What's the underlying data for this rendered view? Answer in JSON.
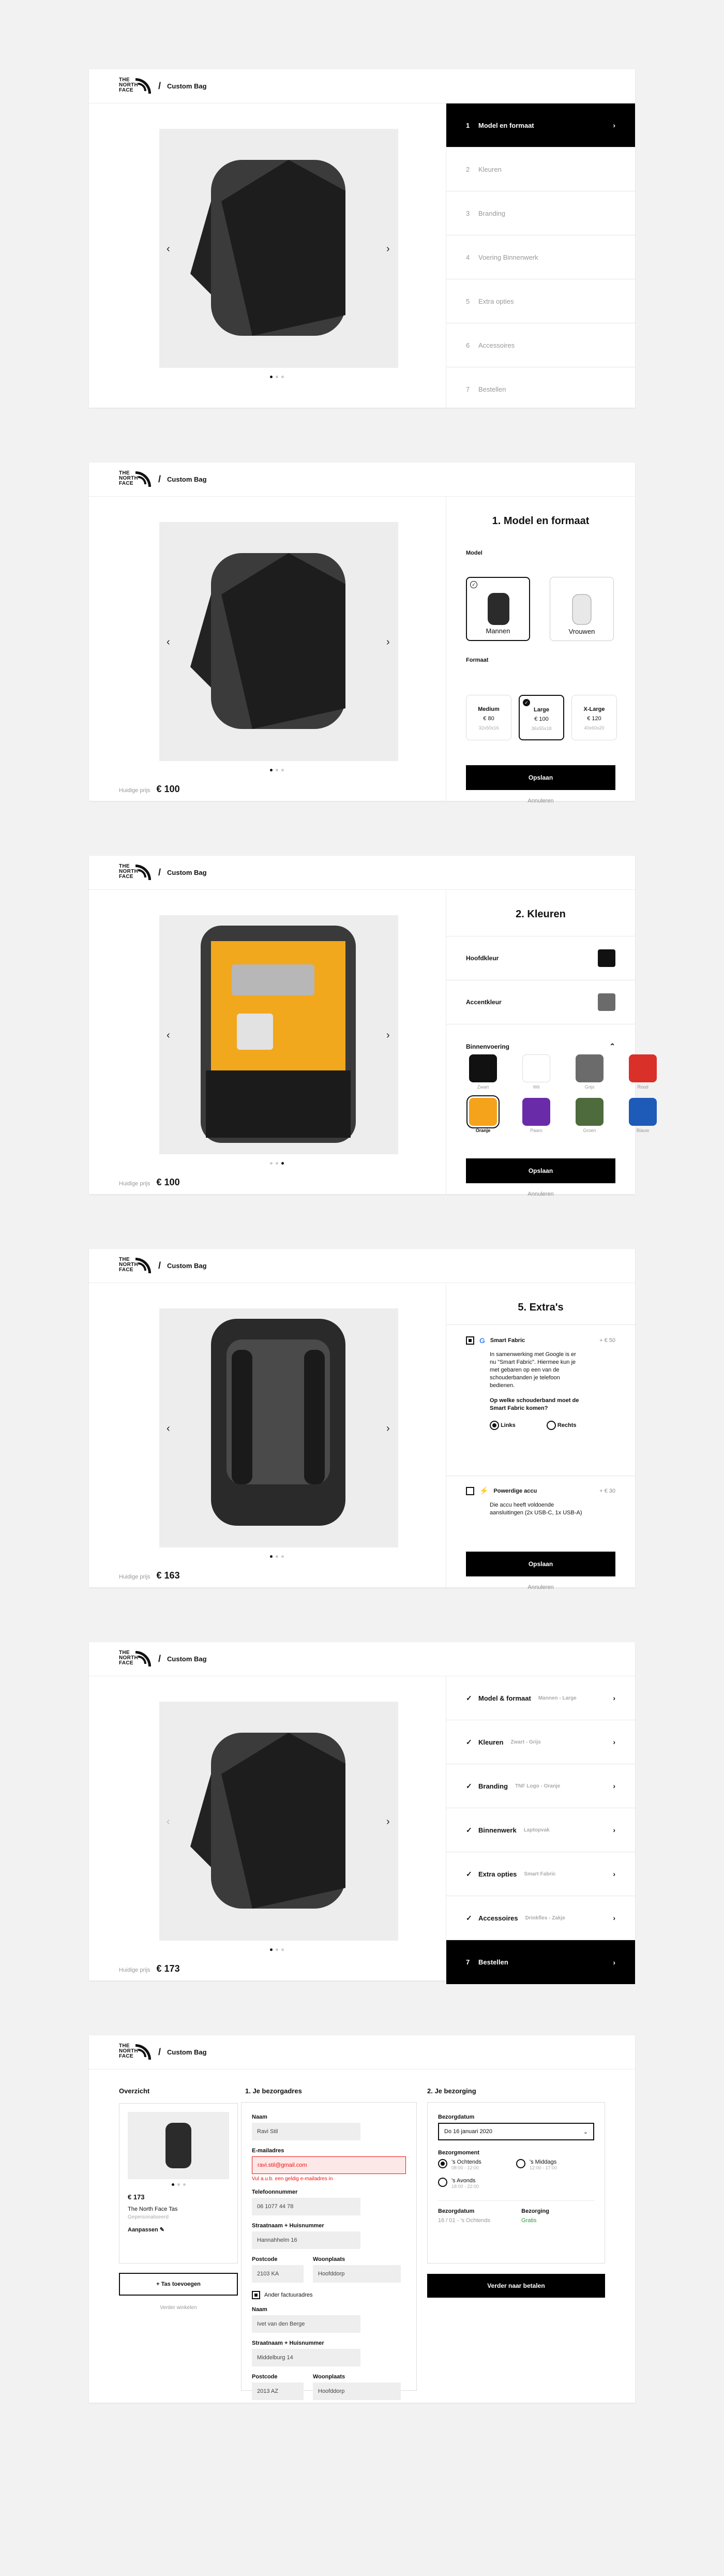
{
  "brand": {
    "logo_text": "THE NORTH FACE",
    "crumb": "Custom Bag"
  },
  "carousel": {
    "prev": "‹",
    "next": "›"
  },
  "common": {
    "price_label": "Huidige prijs",
    "save": "Opslaan",
    "cancel": "Annuleren"
  },
  "s1": {
    "steps": [
      {
        "n": "1",
        "label": "Model en formaat"
      },
      {
        "n": "2",
        "label": "Kleuren"
      },
      {
        "n": "3",
        "label": "Branding"
      },
      {
        "n": "4",
        "label": "Voering Binnenwerk"
      },
      {
        "n": "5",
        "label": "Extra opties"
      },
      {
        "n": "6",
        "label": "Accessoires"
      },
      {
        "n": "7",
        "label": "Bestellen"
      }
    ]
  },
  "s2": {
    "title": "1.   Model en formaat",
    "price": "€ 100",
    "model_label": "Model",
    "men": "Mannen",
    "women": "Vrouwen",
    "size_label": "Formaat",
    "sizes": [
      {
        "name": "Medium",
        "price": "€ 80",
        "dim": "32x50x16"
      },
      {
        "name": "Large",
        "price": "€ 100",
        "dim": "36x55x18"
      },
      {
        "name": "X-Large",
        "price": "€ 120",
        "dim": "40x60x20"
      }
    ]
  },
  "s3": {
    "title": "2.   Kleuren",
    "price": "€ 100",
    "main": "Hoofdkleur",
    "accent": "Accentkleur",
    "inner": "Binnenvoering",
    "swatches": [
      {
        "name": "Zwart",
        "color": "#111111"
      },
      {
        "name": "Wit",
        "color": "#ffffff"
      },
      {
        "name": "Grijs",
        "color": "#6b6b6b"
      },
      {
        "name": "Rood",
        "color": "#d9302a"
      },
      {
        "name": "Oranje",
        "color": "#f5a31a"
      },
      {
        "name": "Paars",
        "color": "#6a2ba8"
      },
      {
        "name": "Groen",
        "color": "#4d6b3d"
      },
      {
        "name": "Blauw",
        "color": "#1e5bb8"
      }
    ]
  },
  "s4": {
    "title": "5.   Extra's",
    "price": "€ 163",
    "o1": {
      "name": "Smart Fabric",
      "price": "+ € 50",
      "desc": "In samenwerking met Google is er nu \"Smart Fabric\". Hiermee kun je met gebaren op een van de schouderbanden je telefoon bedienen.",
      "q": "Op welke schouderband moet de Smart Fabric komen?",
      "left": "Links",
      "right": "Rechts"
    },
    "o2": {
      "name": "Powerdige accu",
      "price": "+ € 30",
      "desc": "Die accu heeft voldoende aansluitingen (2x USB-C, 1x USB-A)"
    }
  },
  "s5": {
    "price": "€ 173",
    "steps": [
      {
        "label": "Model & formaat",
        "sub": "Mannen - Large"
      },
      {
        "label": "Kleuren",
        "sub": "Zwart - Grijs"
      },
      {
        "label": "Branding",
        "sub": "TNF Logo - Oranje"
      },
      {
        "label": "Binnenwerk",
        "sub": "Laptopvak"
      },
      {
        "label": "Extra opties",
        "sub": "Smart Fabric"
      },
      {
        "label": "Accessoires",
        "sub": "Drinkfles - Zakje"
      },
      {
        "label": "Bestellen",
        "n": "7"
      }
    ]
  },
  "s6": {
    "overview": "Overzicht",
    "h1": "1. Je bezorgadres",
    "h2": "2. Je bezorging",
    "sum_price": "€ 173",
    "sum_name": "The North Face Tas",
    "sum_sub": "Gepersonaliseerd",
    "edit": "Aanpassen",
    "add": "Tas toevoegen",
    "continue": "Verder winkelen",
    "f": {
      "naam_l": "Naam",
      "naam": "Ravi Stil",
      "mail_l": "E-mailadres",
      "mail": "ravi.stil@gmail.com",
      "mail_err": "Vul a.u.b. een geldig e-mailadres in",
      "tel_l": "Telefoonnummer",
      "tel": "06 1077 44 78",
      "str_l": "Straatnaam + Huisnummer",
      "str": "Hannahhelm 16",
      "pc_l": "Postcode",
      "pc": "2103 KA",
      "wp_l": "Woonplaats",
      "wp": "Hoofddorp",
      "alt": "Ander factuuradres",
      "naam2": "Ivet van den Berge",
      "str2": "Middelburg 14",
      "pc2": "2013 AZ",
      "wp2": "Hoofddorp"
    },
    "d": {
      "date_l": "Bezorgdatum",
      "date": "Do 16 januari 2020",
      "slot_l": "Bezorgmoment",
      "slots": [
        {
          "t": "'s Ochtends",
          "h": "08:00 - 12:00"
        },
        {
          "t": "'s Middags",
          "h": "12:00 - 17:00"
        },
        {
          "t": "'s Avonds",
          "h": "18:00 - 22:00"
        }
      ],
      "sum_date_l": "Bezorgdatum",
      "sum_date": "16 / 01 - 's Ochtends",
      "sum_cost_l": "Bezorging",
      "sum_cost": "Gratis",
      "next": "Verder naar betalen"
    }
  }
}
